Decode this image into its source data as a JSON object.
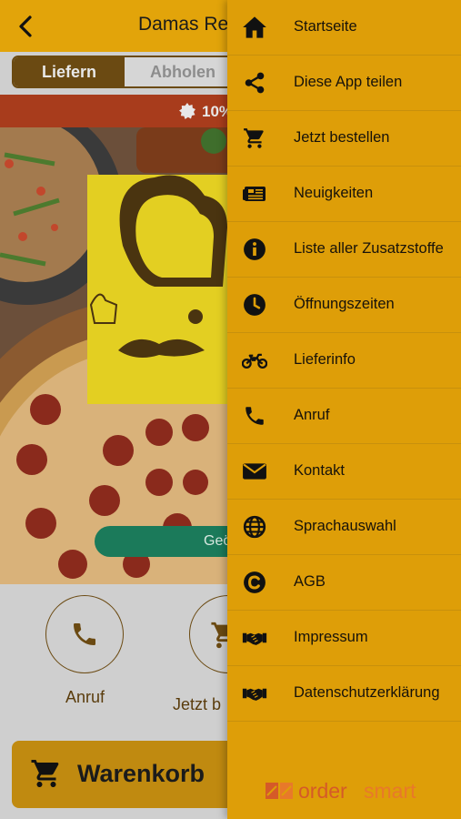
{
  "header": {
    "title": "Damas Res",
    "back_icon": "chevron-left-icon"
  },
  "order_mode": {
    "deliver": "Liefern",
    "pickup": "Abholen"
  },
  "promo": {
    "text": "10%",
    "icon": "badge-icon"
  },
  "open_status": {
    "text": "Geö"
  },
  "actions": [
    {
      "label": "Anruf",
      "icon": "phone-icon"
    },
    {
      "label": "Jetzt b",
      "icon": "cart-icon"
    }
  ],
  "cart": {
    "label": "Warenkorb",
    "icon": "cart-icon"
  },
  "menu": {
    "items": [
      {
        "label": "Startseite",
        "icon": "home-icon"
      },
      {
        "label": "Diese App teilen",
        "icon": "share-icon"
      },
      {
        "label": "Jetzt bestellen",
        "icon": "cart-icon"
      },
      {
        "label": "Neuigkeiten",
        "icon": "news-icon"
      },
      {
        "label": "Liste aller Zusatzstoffe",
        "icon": "info-icon"
      },
      {
        "label": "Öffnungszeiten",
        "icon": "clock-icon"
      },
      {
        "label": "Lieferinfo",
        "icon": "motorcycle-icon"
      },
      {
        "label": "Anruf",
        "icon": "phone-icon"
      },
      {
        "label": "Kontakt",
        "icon": "mail-icon"
      },
      {
        "label": "Sprachauswahl",
        "icon": "globe-icon"
      },
      {
        "label": "AGB",
        "icon": "copyright-icon"
      },
      {
        "label": "Impressum",
        "icon": "handshake-icon"
      },
      {
        "label": "Datenschutzerklärung",
        "icon": "handshake-icon"
      }
    ]
  },
  "brand": {
    "part1": "order",
    "part2": "smart"
  },
  "colors": {
    "accent": "#e2a40a",
    "drawer": "#de9e08",
    "promo": "#a83c1c",
    "status": "#1b7a5a",
    "brown": "#6b4a12"
  }
}
